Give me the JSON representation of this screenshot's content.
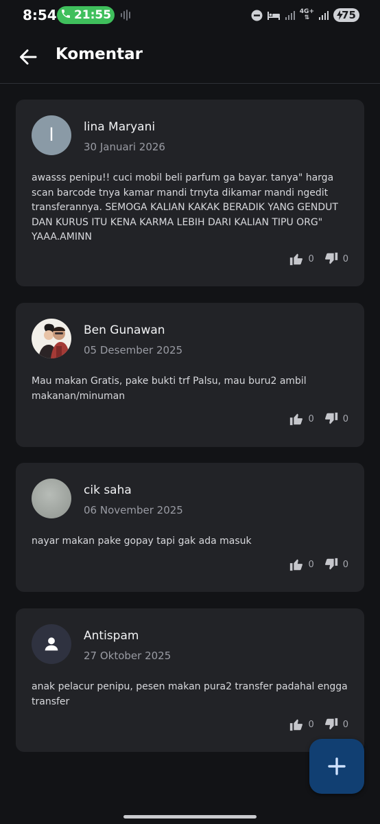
{
  "status_bar": {
    "time": "8:54",
    "call_duration": "21:55",
    "network": "4G+",
    "battery": "75"
  },
  "header": {
    "title": "Komentar"
  },
  "comments": [
    {
      "avatar_letter": "l",
      "name": "lina Maryani",
      "date": "30 Januari 2026",
      "text": "awasss penipu!! cuci mobil beli parfum ga bayar. tanya\" harga scan barcode tnya kamar mandi trnyta dikamar mandi ngedit transferannya. SEMOGA KALIAN KAKAK BERADIK YANG GENDUT DAN KURUS ITU KENA KARMA LEBIH DARI KALIAN TIPU ORG\" YAAA.AMINN",
      "likes": "0",
      "dislikes": "0"
    },
    {
      "name": "Ben Gunawan",
      "date": "05 Desember 2025",
      "text": "Mau makan Gratis, pake bukti trf Palsu, mau buru2 ambil makanan/minuman",
      "likes": "0",
      "dislikes": "0"
    },
    {
      "name": "cik saha",
      "date": "06 November 2025",
      "text": "nayar makan pake gopay tapi gak ada masuk",
      "likes": "0",
      "dislikes": "0"
    },
    {
      "name": "Antispam",
      "date": "27 Oktober 2025",
      "text": "anak pelacur penipu, pesen makan pura2 transfer padahal engga transfer",
      "likes": "0",
      "dislikes": "0"
    }
  ],
  "colors": {
    "background": "#121316",
    "card": "#222327",
    "fab": "#113f72",
    "call_pill": "#3fbf5c"
  },
  "icons": [
    "back-arrow-icon",
    "thumb-up-icon",
    "thumb-down-icon",
    "plus-icon",
    "phone-icon",
    "person-icon"
  ]
}
